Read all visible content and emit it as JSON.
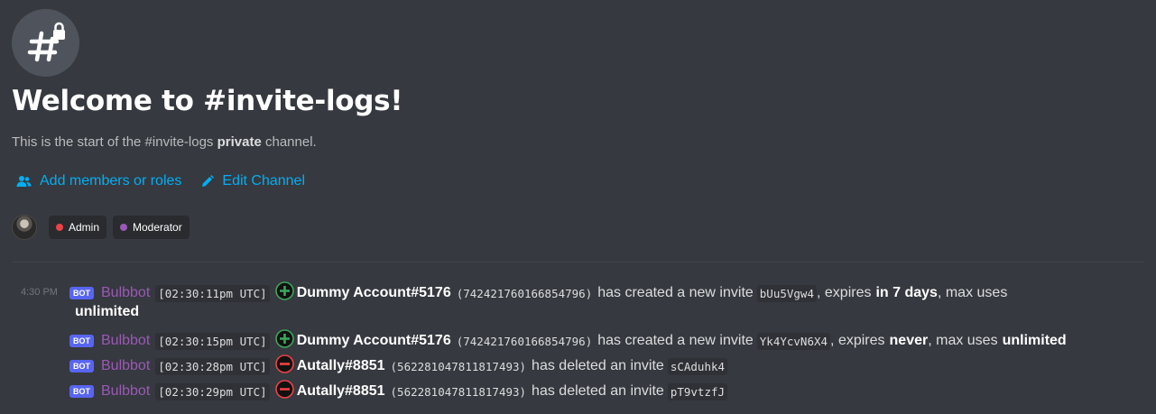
{
  "header": {
    "title": "Welcome to #invite-logs!",
    "subtitle_prefix": "This is the start of the #invite-logs",
    "subtitle_bold": "private",
    "subtitle_suffix": "channel."
  },
  "actions": {
    "add_members_label": "Add members or roles",
    "edit_channel_label": "Edit Channel"
  },
  "roles": [
    {
      "name": "Admin",
      "color": "#ed4245"
    },
    {
      "name": "Moderator",
      "color": "#9b59b6"
    }
  ],
  "timestamp": "4:30 PM",
  "messages": [
    {
      "badge": "BOT",
      "author": "Bulbbot",
      "time": "[02:30:11pm UTC]",
      "icon": "plus-circle-icon",
      "user": "Dummy Account#5176",
      "user_id": "(742421760166854796)",
      "action_text": "has created a new invite",
      "invite_code": "bUu5Vgw4",
      "expires_label": ", expires",
      "expires_value": "in 7 days",
      "max_uses_label": ", max uses",
      "max_uses_value": "unlimited"
    },
    {
      "badge": "BOT",
      "author": "Bulbbot",
      "time": "[02:30:15pm UTC]",
      "icon": "plus-circle-icon",
      "user": "Dummy Account#5176",
      "user_id": "(742421760166854796)",
      "action_text": "has created a new invite",
      "invite_code": "Yk4YcvN6X4",
      "expires_label": ", expires",
      "expires_value": "never",
      "max_uses_label": ", max uses",
      "max_uses_value": "unlimited"
    },
    {
      "badge": "BOT",
      "author": "Bulbbot",
      "time": "[02:30:28pm UTC]",
      "icon": "minus-circle-icon",
      "user": "Autally#8851",
      "user_id": "(562281047811817493)",
      "action_text": "has deleted an invite",
      "invite_code": "sCAduhk4"
    },
    {
      "badge": "BOT",
      "author": "Bulbbot",
      "time": "[02:30:29pm UTC]",
      "icon": "minus-circle-icon",
      "user": "Autally#8851",
      "user_id": "(562281047811817493)",
      "action_text": "has deleted an invite",
      "invite_code": "pT9vtzfJ"
    }
  ],
  "colors": {
    "background": "#36393f",
    "link": "#00aff4",
    "bot_badge": "#5865f2",
    "author": "#9b59b6",
    "create_icon": "#3ba55c",
    "delete_icon": "#ed4245"
  }
}
